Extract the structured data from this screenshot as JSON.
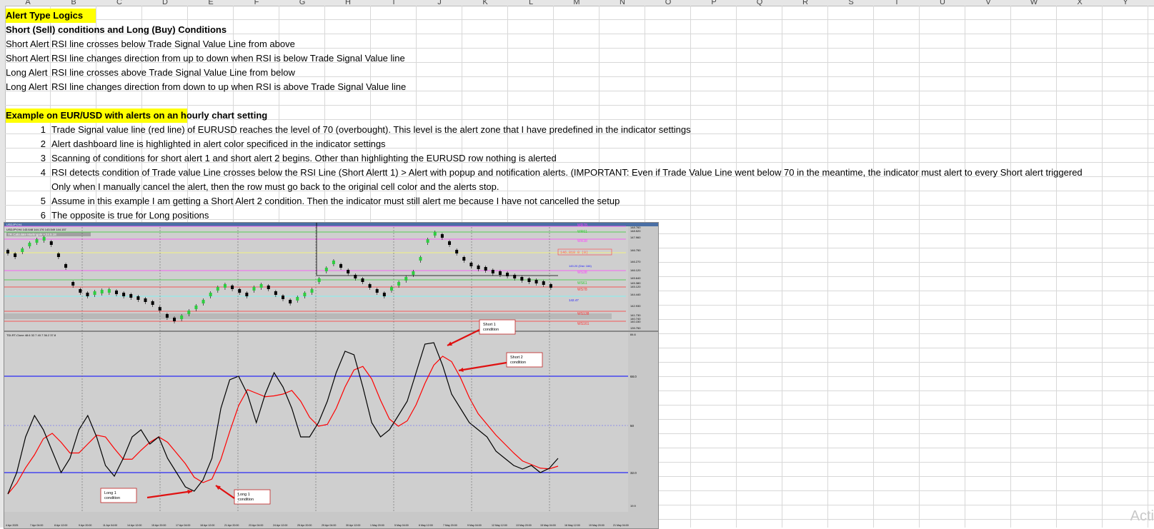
{
  "columns": [
    "A",
    "B",
    "C",
    "D",
    "E",
    "F",
    "G",
    "H",
    "I",
    "J",
    "K",
    "L",
    "M",
    "N",
    "O",
    "P",
    "Q",
    "R",
    "S",
    "T",
    "U",
    "V",
    "W",
    "X",
    "Y"
  ],
  "header": {
    "title": "Alert Type Logics",
    "subtitle": "Short (Sell) conditions and Long (Buy) Conditions"
  },
  "conditions": [
    {
      "type": "Short Alert",
      "text": "RSI line crosses below Trade Signal Value Line from above"
    },
    {
      "type": "Short Alert",
      "text": "RSI line changes direction from up to down when RSI is below Trade Signal Value line"
    },
    {
      "type": "Long Alert",
      "text": "RSI line crosses above Trade Signal Value Line from below"
    },
    {
      "type": "Long Alert",
      "text": "RSI line changes direction from down to up when RSI is above Trade Signal Value line"
    }
  ],
  "example": {
    "heading": "Example on EUR/USD with alerts on an hourly chart setting",
    "steps": [
      {
        "n": "1",
        "text": "Trade Signal value line (red line) of EURUSD reaches the level of 70 (overbought). This level is the alert zone that I have predefined in the indicator settings"
      },
      {
        "n": "2",
        "text": "Alert dashboard line is highlighted in alert color specificed in the indicator settings"
      },
      {
        "n": "3",
        "text": "Scanning of conditions for short alert 1 and short alert 2 begins. Other than highlighting the EURUSD row nothing is alerted"
      },
      {
        "n": "4",
        "text": "RSI detects condition of Trade value Line crosses below the RSI Line (Short Alertt 1)  > Alert with popup and notification alerts. (IMPORTANT: Even if Trade Value Line went below 70 in the meantime, the indicator must alert to every Short alert triggered"
      },
      {
        "n": "",
        "text": "Only when I manually cancel the alert, then the row must go back to the original cell color and the alerts stop."
      },
      {
        "n": "5",
        "text": "Assume in this example I am getting a Short Alert 2 condition. Then the indicator must still alert me because I have not cancelled the setup"
      },
      {
        "n": "6",
        "text": "The opposite is true for Long positions"
      }
    ]
  },
  "chart": {
    "symbol": "USDJPY,H4",
    "quote": "USDJPY,H4  143.648 144.176 143.549 144.157",
    "indicator_tag": "TR Calculate Martingale v.24.5.18",
    "osc_label": "TDI-RT-Clone 48.6 32.7 40.7 36.2 37.8",
    "price_right": [
      "148.760",
      "148.520",
      "147.960",
      "146.750",
      "146.270",
      "146.120",
      "145.640",
      "145.380",
      "145.120",
      "144.440",
      "142.930",
      "141.730",
      "140.740",
      "140.150",
      "139.750"
    ],
    "level_labels": [
      {
        "label": "WR78",
        "color": "#ff40ff"
      },
      {
        "label": "WR61",
        "color": "#33cc33"
      },
      {
        "label": "WR38",
        "color": "#ff40ff"
      },
      {
        "label": "WS38",
        "color": "#ff40ff"
      },
      {
        "label": "WS61",
        "color": "#33cc33"
      },
      {
        "label": "WS78",
        "color": "#ff3030"
      },
      {
        "label": "WS138",
        "color": "#ff3030"
      },
      {
        "label": "WS161",
        "color": "#ff3030"
      }
    ],
    "price_box": "146.810 0 (0)",
    "dist_label": "145.20  (Dist: 166)",
    "low_label": "142.47",
    "osc_levels": [
      "68.0",
      "50",
      "32.0"
    ],
    "osc_bottom": "19.9",
    "osc_top": "84.6",
    "callouts": {
      "short1": "Short 1 condition",
      "short2": "Short 2 condition",
      "long1a": "Long 1 condition",
      "long1b": "Long 1 condition"
    },
    "date_labels": [
      "4 Apr 2025",
      "7 Apr 04:00",
      "8 Apr 12:00",
      "9 Apr 20:00",
      "11 Apr 04:00",
      "14 Apr 12:00",
      "15 Apr 20:00",
      "17 Apr 04:00",
      "18 Apr 12:00",
      "21 Apr 20:00",
      "23 Apr 04:00",
      "24 Apr 12:00",
      "25 Apr 20:00",
      "29 Apr 04:00",
      "30 Apr 12:00",
      "1 May 20:00",
      "5 May 04:00",
      "6 May 12:00",
      "7 May 20:00",
      "9 May 04:00",
      "12 May 12:00",
      "13 May 20:00",
      "15 May 04:00",
      "16 May 12:00",
      "19 May 20:00",
      "21 May 04:00"
    ]
  },
  "watermark": "Acti"
}
